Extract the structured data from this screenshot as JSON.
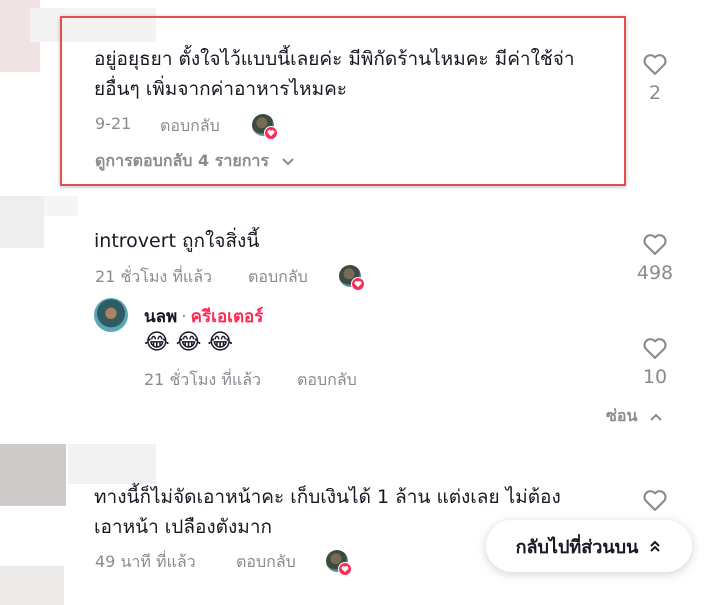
{
  "comments": [
    {
      "text_line1": "อยู่อยุธยา ตั้งใจไว้แบบนี้เลยค่ะ มีพิกัดร้านไหมคะ มีค่าใช้จ่า",
      "text_line2": "ยอื่นๆ เพิ่มจากค่าอาหารไหมคะ",
      "time": "9-21",
      "reply_label": "ตอบกลับ",
      "likes": "2",
      "view_replies": "ดูการตอบกลับ 4 รายการ"
    },
    {
      "text_line1": "introvert ถูกใจสิ่งนี้",
      "time": "21 ชั่วโมง ที่แล้ว",
      "reply_label": "ตอบกลับ",
      "likes": "498",
      "reply": {
        "author": "นลพ",
        "separator": "·",
        "role": "ครีเอเตอร์",
        "emojis": "😂😂😂",
        "time": "21 ชั่วโมง ที่แล้ว",
        "reply_label": "ตอบกลับ",
        "likes": "10"
      },
      "hide_label": "ซ่อน"
    },
    {
      "text_line1": "ทางนี้ก็ไม่จัดเอาหน้าคะ เก็บเงินได้ 1 ล้าน แต่งเลย ไม่ต้อง",
      "text_line2": "เอาหน้า เปลืองตังมาก",
      "time": "49 นาที ที่แล้ว",
      "reply_label": "ตอบกลับ"
    }
  ],
  "back_to_top": "กลับไปที่ส่วนบน",
  "colors": {
    "highlight_border": "#e34f4f",
    "creator_accent": "#fe2c55",
    "muted_text": "#8a8b91"
  }
}
